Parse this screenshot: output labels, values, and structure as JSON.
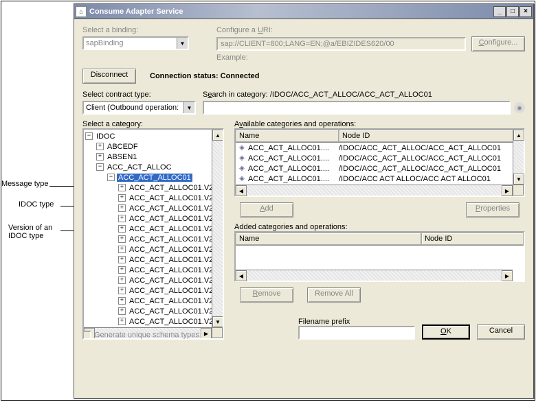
{
  "window": {
    "title": "Consume Adapter Service"
  },
  "labels": {
    "select_binding": "Select a binding:",
    "binding_value": "sapBinding",
    "configure_uri_pre": "Configure a ",
    "configure_uri_u": "U",
    "configure_uri_post": "RI:",
    "uri_value": "sap://CLIENT=800;LANG=EN;@a/EBIZIDES620/00",
    "configure_btn_u": "C",
    "configure_btn_post": "onfigure...",
    "example": "Example:",
    "disconnect": "Disconnect",
    "status_label": "Connection status: ",
    "status_value": "Connected",
    "select_contract": "Select contract type:",
    "contract_value": "Client (Outbound operation:",
    "search_prefix": "S",
    "search_mid": "e",
    "search_post": "arch in category: ",
    "search_path": "/IDOC/ACC_ACT_ALLOC/ACC_ACT_ALLOC01",
    "select_category": "Select a category:",
    "available_prefix": "A",
    "available_u": "v",
    "available_post": "ailable categories and operations:",
    "col_name": "Name",
    "col_node": "Node ID",
    "add_u": "A",
    "add_post": "dd",
    "props_u": "P",
    "props_post": "roperties",
    "added_label": "Added categories and operations:",
    "remove_u": "R",
    "remove_post": "emove",
    "remove_all": "Remove All",
    "gen_schema": "Generate unique schema types",
    "filename_prefix": "Filename prefix",
    "ok_u": "O",
    "ok_post": "K",
    "cancel": "Cancel"
  },
  "tree": {
    "root": "IDOC",
    "l1": [
      "ABCEDF",
      "ABSEN1"
    ],
    "msg_type": "ACC_ACT_ALLOC",
    "idoc_type": "ACC_ACT_ALLOC01",
    "v2": "ACC_ACT_ALLOC01.V2"
  },
  "available": [
    {
      "name": "ACC_ACT_ALLOC01....",
      "node": "/IDOC/ACC_ACT_ALLOC/ACC_ACT_ALLOC01"
    },
    {
      "name": "ACC_ACT_ALLOC01....",
      "node": "/IDOC/ACC_ACT_ALLOC/ACC_ACT_ALLOC01"
    },
    {
      "name": "ACC_ACT_ALLOC01....",
      "node": "/IDOC/ACC_ACT_ALLOC/ACC_ACT_ALLOC01"
    },
    {
      "name": "ACC_ACT_ALLOC01....",
      "node": "/IDOC/ACC ACT ALLOC/ACC ACT ALLOC01"
    }
  ],
  "annotations": {
    "msg": "Message type",
    "idoc": "IDOC type",
    "ver": "Version of an IDOC type"
  }
}
